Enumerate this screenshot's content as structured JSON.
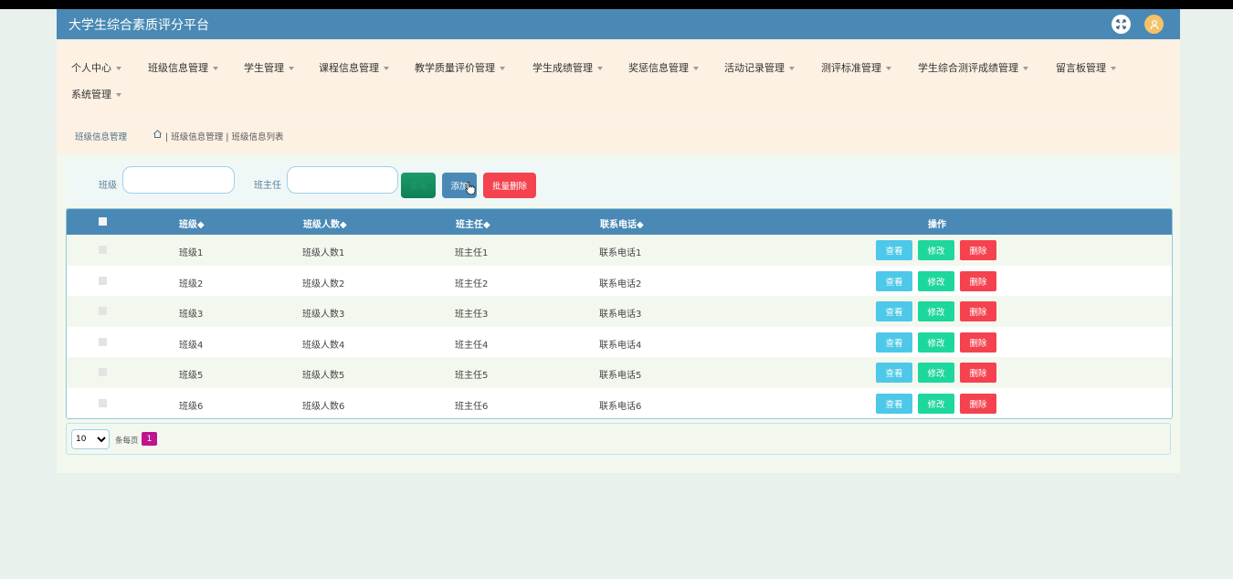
{
  "header": {
    "title": "大学生综合素质评分平台"
  },
  "menu": {
    "items": [
      {
        "label": "个人中心"
      },
      {
        "label": "班级信息管理"
      },
      {
        "label": "学生管理"
      },
      {
        "label": "课程信息管理"
      },
      {
        "label": "教学质量评价管理"
      },
      {
        "label": "学生成绩管理"
      },
      {
        "label": "奖惩信息管理"
      },
      {
        "label": "活动记录管理"
      },
      {
        "label": "测评标准管理"
      },
      {
        "label": "学生综合测评成绩管理"
      },
      {
        "label": "留言板管理"
      },
      {
        "label": "系统管理"
      }
    ]
  },
  "breadcrumb": {
    "section": "班级信息管理",
    "path": "| 班级信息管理 | 班级信息列表"
  },
  "search": {
    "class_label": "班级",
    "class_value": "",
    "teacher_label": "班主任",
    "teacher_value": "",
    "search_button": "查询",
    "add_button": "添加",
    "batch_delete_button": "批量删除"
  },
  "table": {
    "headers": [
      "班级◆",
      "班级人数◆",
      "班主任◆",
      "联系电话◆",
      "操作"
    ],
    "rows": [
      {
        "class": "班级1",
        "count": "班级人数1",
        "teacher": "班主任1",
        "phone": "联系电话1"
      },
      {
        "class": "班级2",
        "count": "班级人数2",
        "teacher": "班主任2",
        "phone": "联系电话2"
      },
      {
        "class": "班级3",
        "count": "班级人数3",
        "teacher": "班主任3",
        "phone": "联系电话3"
      },
      {
        "class": "班级4",
        "count": "班级人数4",
        "teacher": "班主任4",
        "phone": "联系电话4"
      },
      {
        "class": "班级5",
        "count": "班级人数5",
        "teacher": "班主任5",
        "phone": "联系电话5"
      },
      {
        "class": "班级6",
        "count": "班级人数6",
        "teacher": "班主任6",
        "phone": "联系电话6"
      }
    ],
    "actions": {
      "view": "查看",
      "edit": "修改",
      "delete": "删除"
    },
    "row_colors": [
      "#f3f8ef",
      "#ffffff"
    ]
  },
  "pager": {
    "page_size": "10",
    "per_page_label": "条每页",
    "current_page": "1"
  },
  "colors": {
    "header": "#4a89b5",
    "menu_bg": "#fdf1e3",
    "accent_pink": "#c0148e",
    "delete_red": "#f5424f"
  }
}
